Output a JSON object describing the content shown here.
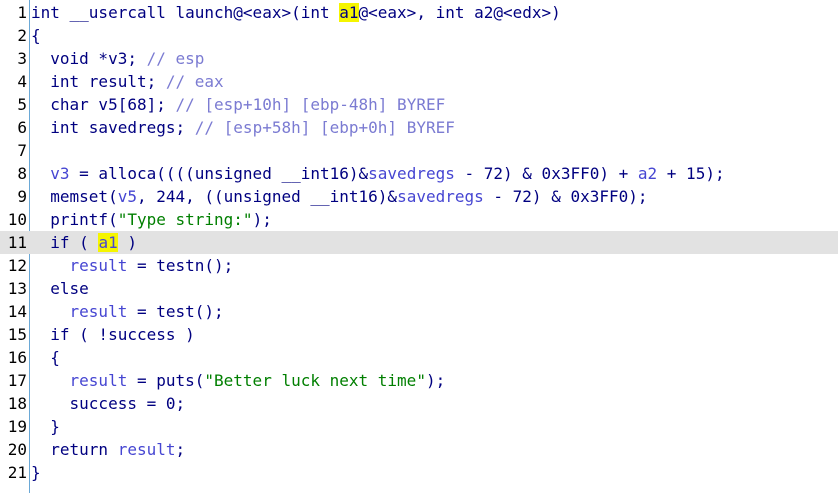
{
  "line_numbers": [
    "1",
    "2",
    "3",
    "4",
    "5",
    "6",
    "7",
    "8",
    "9",
    "10",
    "11",
    "12",
    "13",
    "14",
    "15",
    "16",
    "17",
    "18",
    "19",
    "20",
    "21"
  ],
  "current_line": 11,
  "highlight_identifier": "a1",
  "code": {
    "l1": {
      "a": "int __usercall launch@<eax>(int ",
      "b": "a1",
      "c": "@<eax>, int a2@<edx>)"
    },
    "l2": {
      "a": "{"
    },
    "l3": {
      "a": "  void *v3; ",
      "b": "// esp"
    },
    "l4": {
      "a": "  int result; ",
      "b": "// eax"
    },
    "l5": {
      "a": "  char v5[68]; ",
      "b": "// [esp+10h] [ebp-48h] BYREF"
    },
    "l6": {
      "a": "  int savedregs; ",
      "b": "// [esp+58h] [ebp+0h] BYREF"
    },
    "l7": {
      "a": ""
    },
    "l8": {
      "a": "  ",
      "b": "v3",
      "c": " = alloca((((unsigned __int16)&",
      "d": "savedregs",
      "e": " - 72) & 0x3FF0) + ",
      "f": "a2",
      "g": " + 15);"
    },
    "l9": {
      "a": "  memset(",
      "b": "v5",
      "c": ", 244, ((unsigned __int16)&",
      "d": "savedregs",
      "e": " - 72) & 0x3FF0);"
    },
    "l10": {
      "a": "  printf(",
      "b": "\"Type string:\"",
      "c": ");"
    },
    "l11": {
      "a": "  if ( ",
      "b": "a1",
      "c": " )"
    },
    "l12": {
      "a": "    ",
      "b": "result",
      "c": " = testn();"
    },
    "l13": {
      "a": "  else"
    },
    "l14": {
      "a": "    ",
      "b": "result",
      "c": " = test();"
    },
    "l15": {
      "a": "  if ( !success )"
    },
    "l16": {
      "a": "  {"
    },
    "l17": {
      "a": "    ",
      "b": "result",
      "c": " = puts(",
      "d": "\"Better luck next time\"",
      "e": ");"
    },
    "l18": {
      "a": "    success = 0;"
    },
    "l19": {
      "a": "  }"
    },
    "l20": {
      "a": "  return ",
      "b": "result",
      "c": ";"
    },
    "l21": {
      "a": "}"
    }
  }
}
